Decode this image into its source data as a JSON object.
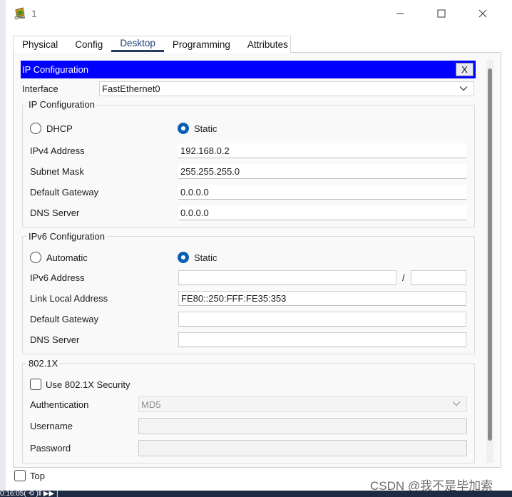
{
  "window": {
    "title": "1",
    "icon": "packet-tracer-pc-icon"
  },
  "tabs": [
    {
      "label": "Physical",
      "active": false
    },
    {
      "label": "Config",
      "active": false
    },
    {
      "label": "Desktop",
      "active": true
    },
    {
      "label": "Programming",
      "active": false
    },
    {
      "label": "Attributes",
      "active": false
    }
  ],
  "ip_config": {
    "header": "IP Configuration",
    "close_label": "X",
    "interface_label": "Interface",
    "interface_value": "FastEthernet0",
    "ipv4": {
      "title": "IP Configuration",
      "dhcp_label": "DHCP",
      "static_label": "Static",
      "mode": "Static",
      "address_label": "IPv4 Address",
      "address_value": "192.168.0.2",
      "mask_label": "Subnet Mask",
      "mask_value": "255.255.255.0",
      "gateway_label": "Default Gateway",
      "gateway_value": "0.0.0.0",
      "dns_label": "DNS Server",
      "dns_value": "0.0.0.0"
    },
    "ipv6": {
      "title": "IPv6 Configuration",
      "automatic_label": "Automatic",
      "static_label": "Static",
      "mode": "Static",
      "address_label": "IPv6 Address",
      "address_value": "",
      "prefix_separator": "/",
      "prefix_value": "",
      "link_local_label": "Link Local Address",
      "link_local_value": "FE80::250:FFF:FE35:353",
      "gateway_label": "Default Gateway",
      "gateway_value": "",
      "dns_label": "DNS Server",
      "dns_value": ""
    },
    "dot1x": {
      "title": "802.1X",
      "use_security_label": "Use 802.1X Security",
      "use_security_checked": false,
      "auth_label": "Authentication",
      "auth_value": "MD5",
      "username_label": "Username",
      "username_value": "",
      "password_label": "Password",
      "password_value": ""
    }
  },
  "footer": {
    "top_label": "Top",
    "top_checked": false
  },
  "taskbar": {
    "text": "0:16:05( ⟲ )‖ ▶▶ |"
  },
  "watermark": "CSDN @我不是毕加索",
  "colors": {
    "header_bg": "#0000ff",
    "radio_selected": "#0a5fb5",
    "active_tab_underline": "#233c64"
  }
}
